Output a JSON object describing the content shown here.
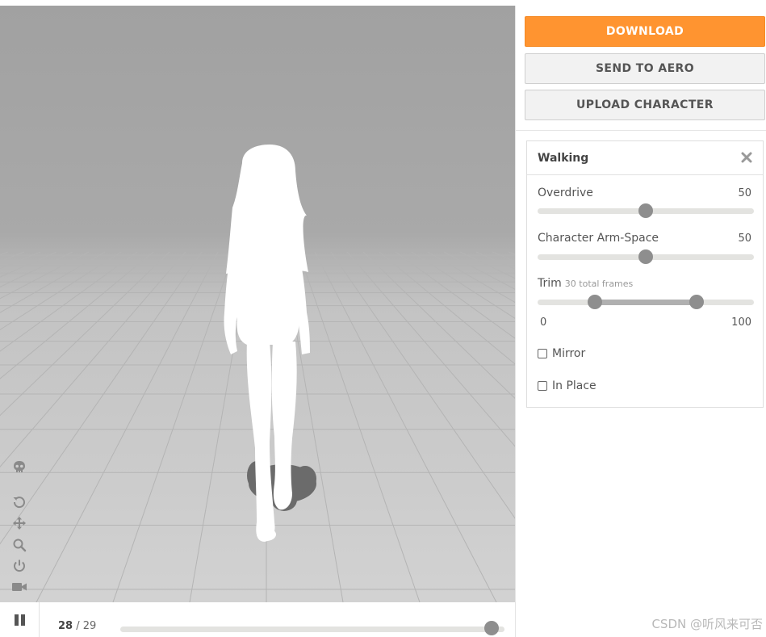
{
  "actions": {
    "download_label": "DOWNLOAD",
    "send_label": "SEND TO AERO",
    "upload_label": "UPLOAD CHARACTER"
  },
  "animation_card": {
    "title": "Walking",
    "overdrive": {
      "label": "Overdrive",
      "value": "50",
      "level": 50
    },
    "arm_space": {
      "label": "Character Arm-Space",
      "value": "50",
      "level": 50
    },
    "trim": {
      "label": "Trim",
      "sublabel": "30 total frames",
      "min_label": "0",
      "max_label": "100",
      "start": 26.5,
      "end": 73.5
    },
    "mirror_label": "Mirror",
    "in_place_label": "In Place"
  },
  "viewport_tools": [
    "skeleton-icon",
    "reset-icon",
    "move-icon",
    "zoom-icon",
    "power-icon",
    "camera-icon"
  ],
  "playback": {
    "current_frame": "28",
    "separator": " / ",
    "total_frames": "29",
    "progress": 0.966
  },
  "watermark": "CSDN @听风来可否",
  "colors": {
    "accent": "#ff9430",
    "slider_thumb": "#8e8e8e",
    "floor": "#cfcfcf"
  }
}
